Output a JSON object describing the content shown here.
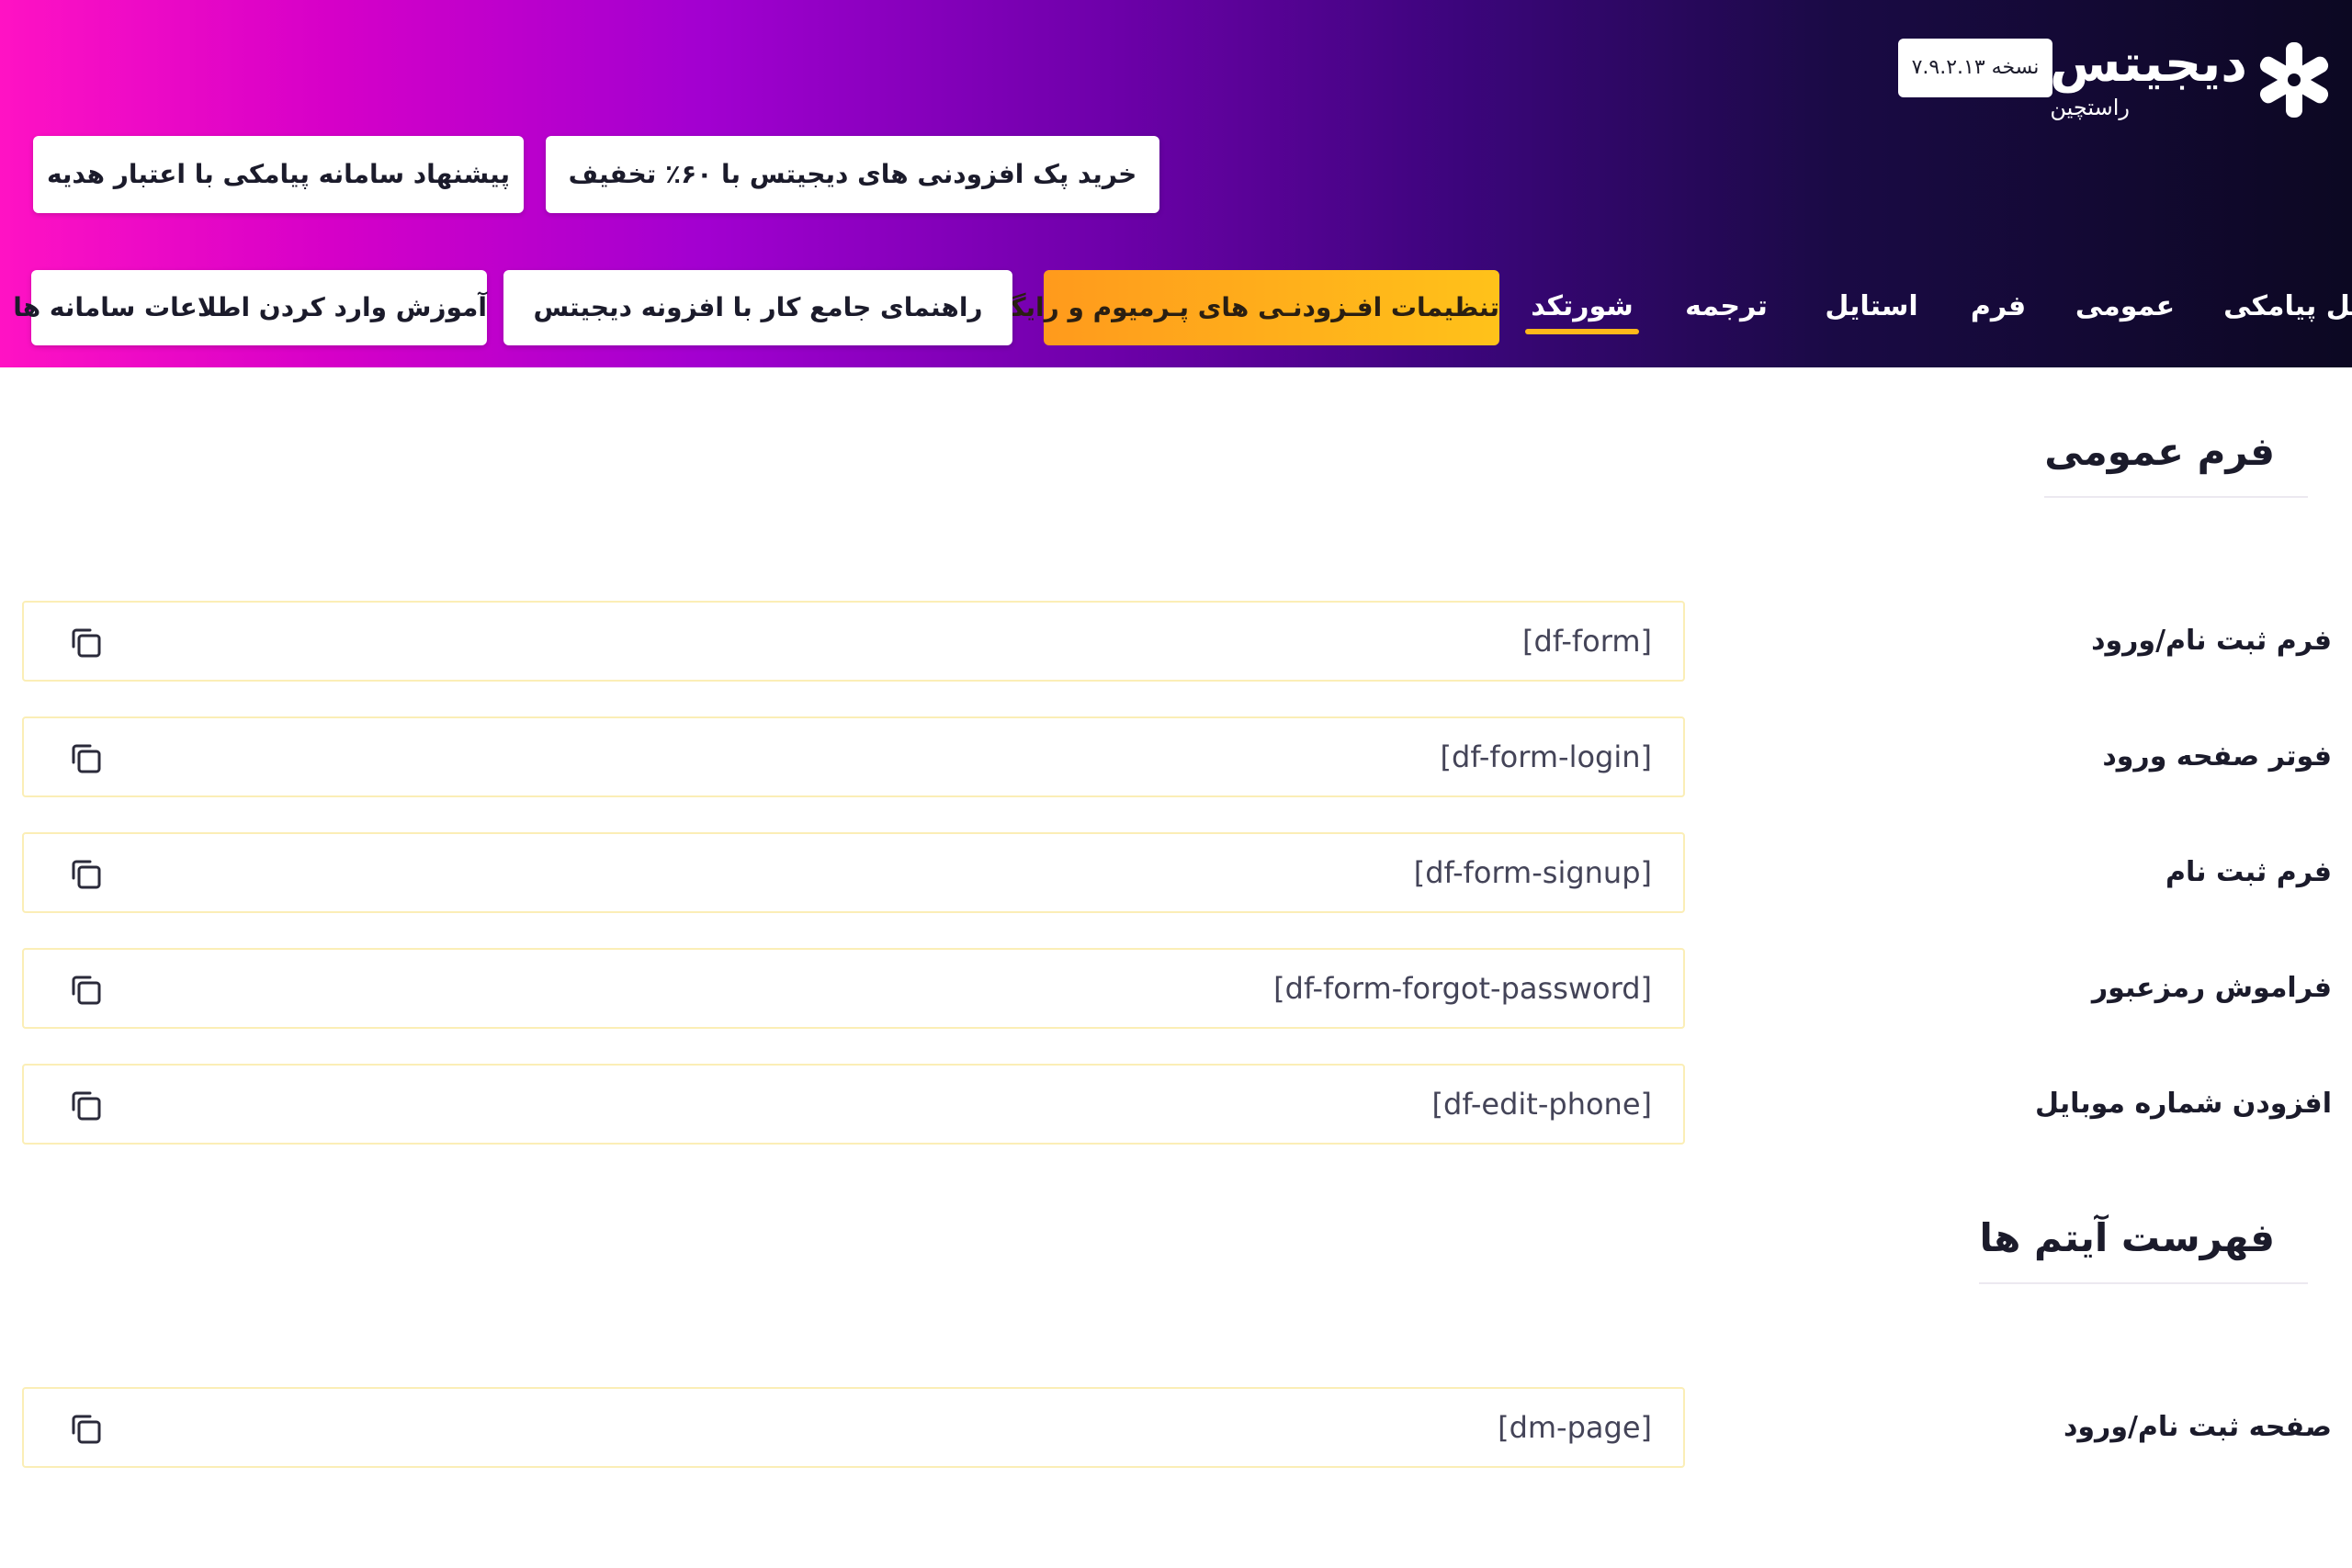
{
  "brand": {
    "name": "دیجیتس",
    "subtitle": "راستچین",
    "version": "نسخه ۷.۹.۲.۱۳",
    "colors": {
      "gradient_start": "#ff12c4",
      "gradient_end": "#0c0822",
      "accent": "#ffb81a"
    }
  },
  "promos": {
    "buy_pack": "خرید پک افزودنی های دیجیتس با ۶۰٪ تخفیف",
    "sms_offer": "پیشنهاد سامانه پیامکی با اعتبار هدیه"
  },
  "nav": {
    "tabs": [
      {
        "label": "پنل پیامکی",
        "active": false
      },
      {
        "label": "عمومی",
        "active": false
      },
      {
        "label": "فرم",
        "active": false
      },
      {
        "label": "استایل",
        "active": false
      },
      {
        "label": "ترجمه",
        "active": false
      },
      {
        "label": "شورتکد",
        "active": true
      }
    ],
    "premium_settings": "تنظیمات افـزودنـی های پـرمیوم و رایگان",
    "guide": "راهنمای جامع کار با افزونه دیجیتس",
    "tutorial": "آموزش وارد کردن اطلاعات سامانه ها"
  },
  "sections": {
    "general_form": {
      "title": "فرم عمومی",
      "rows": [
        {
          "label": "فرم ثبت نام/ورود",
          "shortcode": "[df-form]"
        },
        {
          "label": "فوتر صفحه ورود",
          "shortcode": "[df-form-login]"
        },
        {
          "label": "فرم ثبت نام",
          "shortcode": "[df-form-signup]"
        },
        {
          "label": "فراموش رمزعبور",
          "shortcode": "[df-form-forgot-password]"
        },
        {
          "label": "افزودن شماره موبایل",
          "shortcode": "[df-edit-phone]"
        }
      ]
    },
    "menu_items": {
      "title": "فهرست آیتم ها",
      "rows": [
        {
          "label": "صفحه ثبت نام/ورود",
          "shortcode": "[dm-page]"
        }
      ]
    }
  },
  "icons": {
    "logo": "digits-asterisk-logo",
    "copy": "copy-icon"
  }
}
